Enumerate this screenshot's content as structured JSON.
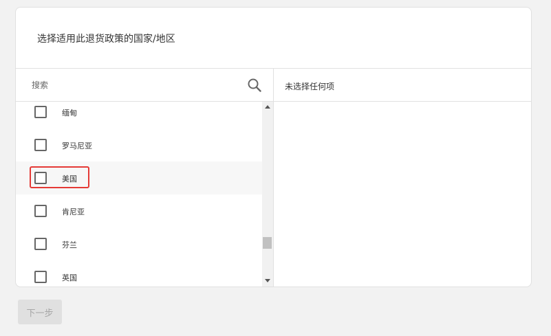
{
  "card": {
    "title": "选择适用此退货政策的国家/地区"
  },
  "search": {
    "placeholder": "搜索",
    "icon": "search-icon"
  },
  "selected_panel": {
    "header": "未选择任何项"
  },
  "country_list": [
    {
      "label": "缅甸",
      "checked": false
    },
    {
      "label": "罗马尼亚",
      "checked": false
    },
    {
      "label": "美国",
      "checked": false,
      "highlighted": true
    },
    {
      "label": "肯尼亚",
      "checked": false
    },
    {
      "label": "芬兰",
      "checked": false
    },
    {
      "label": "英国",
      "checked": false
    }
  ],
  "footer": {
    "next_label": "下一步"
  },
  "colors": {
    "highlight": "#e53935",
    "disabled_button_bg": "#e0e0e0",
    "disabled_button_text": "#a6a6a6"
  }
}
